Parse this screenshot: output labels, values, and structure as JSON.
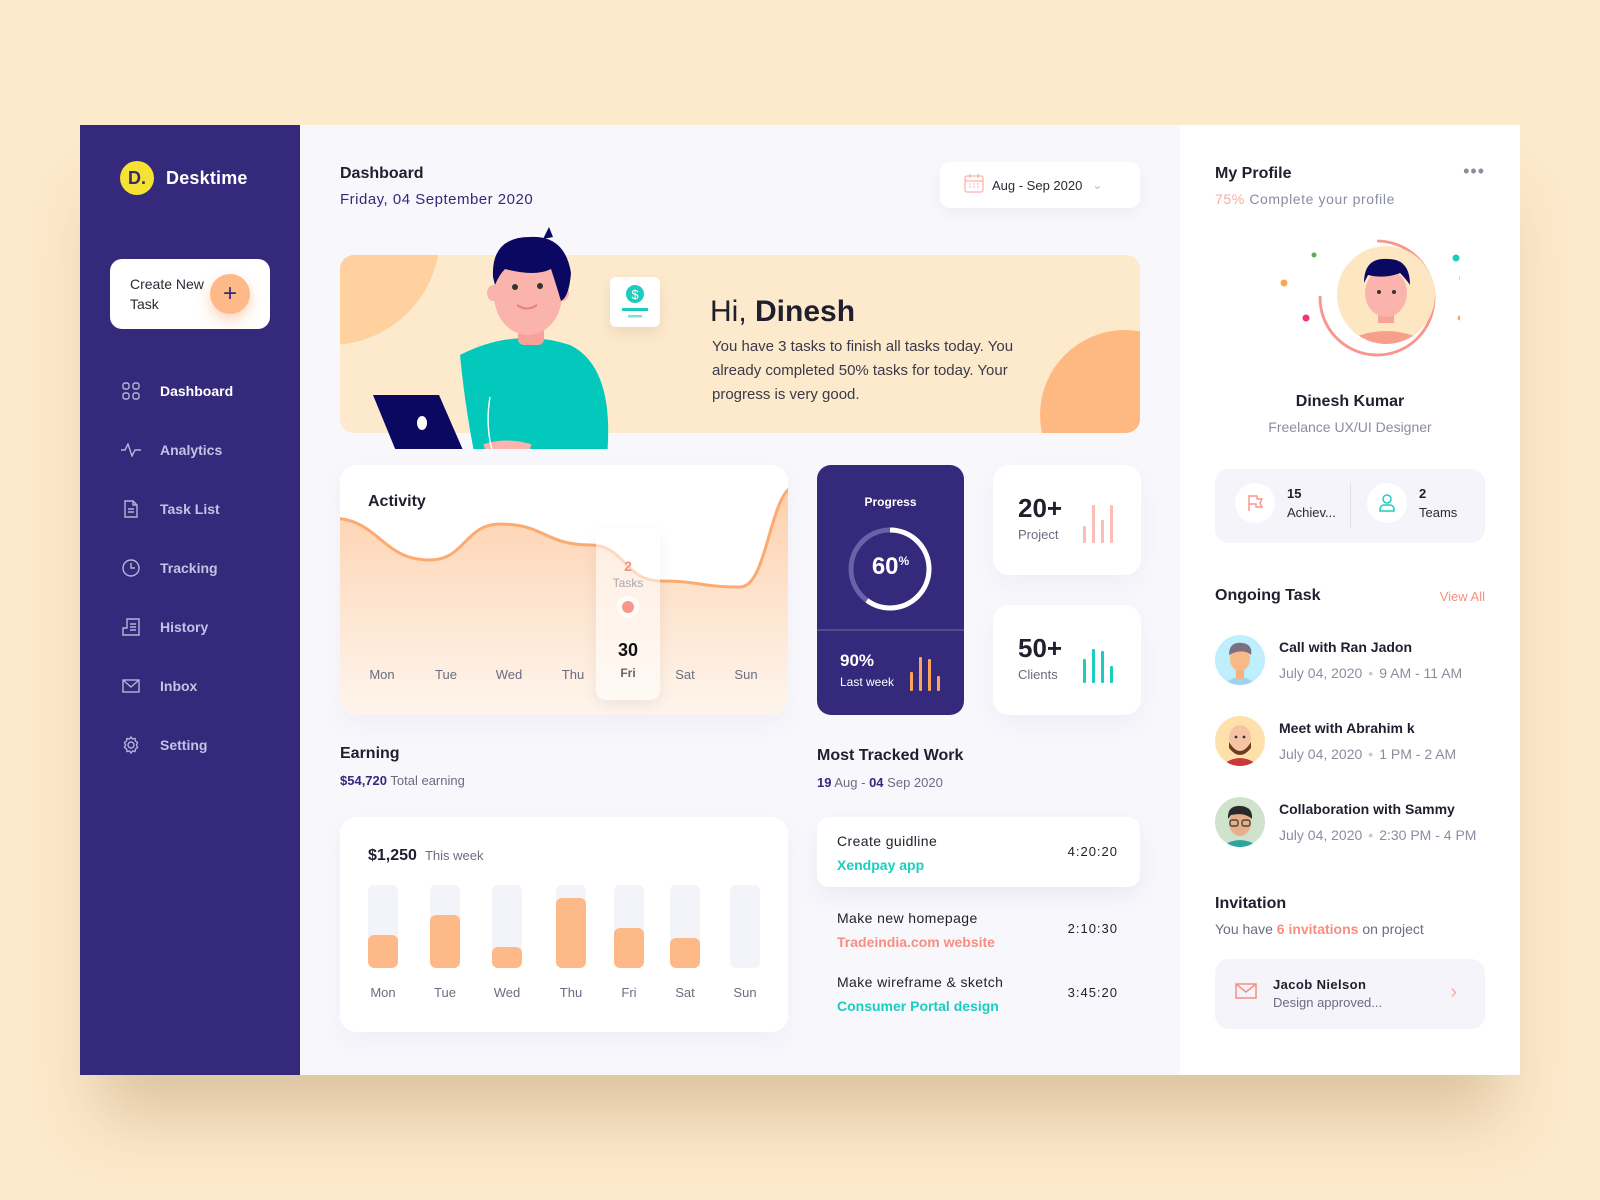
{
  "app": {
    "name": "Desktime",
    "logo_letter": "D."
  },
  "sidebar": {
    "create_button": {
      "label": "Create New Task",
      "icon": "plus-icon"
    },
    "items": [
      {
        "label": "Dashboard",
        "icon": "grid-icon",
        "active": true
      },
      {
        "label": "Analytics",
        "icon": "pulse-icon",
        "active": false
      },
      {
        "label": "Task List",
        "icon": "document-icon",
        "active": false
      },
      {
        "label": "Tracking",
        "icon": "clock-icon",
        "active": false
      },
      {
        "label": "History",
        "icon": "history-icon",
        "active": false
      },
      {
        "label": "Inbox",
        "icon": "mail-icon",
        "active": false
      },
      {
        "label": "Setting",
        "icon": "gear-icon",
        "active": false
      }
    ]
  },
  "header": {
    "title": "Dashboard",
    "date": "Friday, 04 September 2020",
    "date_range": "Aug - Sep 2020"
  },
  "banner": {
    "greeting_prefix": "Hi, ",
    "greeting_name": "Dinesh",
    "message": "You have 3 tasks to finish all tasks today. You already completed 50% tasks for today. Your progress is very good."
  },
  "activity": {
    "title": "Activity",
    "days": [
      "Mon",
      "Tue",
      "Wed",
      "Thu",
      "Fri",
      "Sat",
      "Sun"
    ],
    "tooltip": {
      "count": "2",
      "label": "Tasks",
      "date": "30",
      "day": "Fri"
    }
  },
  "progress": {
    "title": "Progress",
    "percent_value": 60,
    "percent_label": "60",
    "percent_sign": "%",
    "last_week_value": "90%",
    "last_week_label": "Last week",
    "bars": [
      0.55,
      1.0,
      0.95,
      0.45
    ]
  },
  "stats": [
    {
      "value": "20+",
      "label": "Project",
      "color": "#fcbdb6",
      "bars": [
        0.45,
        1.0,
        0.6,
        1.0
      ]
    },
    {
      "value": "50+",
      "label": "Clients",
      "color": "#1ccdbf",
      "bars": [
        0.7,
        1.0,
        0.95,
        0.5
      ]
    }
  ],
  "earning": {
    "title": "Earning",
    "total_value": "$54,720",
    "total_label": "Total earning",
    "week_value": "$1,250",
    "week_label": "This week"
  },
  "chart_data": {
    "type": "bar",
    "title": "$1,250 This week",
    "categories": [
      "Mon",
      "Tue",
      "Wed",
      "Thu",
      "Fri",
      "Sat",
      "Sun"
    ],
    "values": [
      0.4,
      0.64,
      0.25,
      0.84,
      0.48,
      0.36,
      0
    ],
    "ylim": [
      0,
      1
    ],
    "xlabel": "",
    "ylabel": "",
    "grid": false
  },
  "activity_chart": {
    "type": "area",
    "categories": [
      "Mon",
      "Tue",
      "Wed",
      "Thu",
      "Fri",
      "Sat",
      "Sun"
    ],
    "values": [
      0.78,
      0.5,
      0.74,
      0.6,
      0.36,
      0.32,
      1.0
    ],
    "highlight": "Fri"
  },
  "tracked": {
    "title": "Most Tracked Work",
    "range_start_day": "19",
    "range_start_month": "Aug",
    "range_end_day": "04",
    "range_end_rest": "Sep 2020",
    "items": [
      {
        "name": "Create guidline",
        "project": "Xendpay app",
        "time": "4:20:20",
        "color": "#1ccdbf"
      },
      {
        "name": "Make new homepage",
        "project": "Tradeindia.com website",
        "time": "2:10:30",
        "color": "#f78e80"
      },
      {
        "name": "Make wireframe & sketch",
        "project": "Consumer Portal design",
        "time": "3:45:20",
        "color": "#1ccdbf"
      }
    ]
  },
  "profile": {
    "title": "My Profile",
    "complete_pct": "75%",
    "complete_label": "Complete your profile",
    "more_icon": "more-dots-icon",
    "name": "Dinesh Kumar",
    "role": "Freelance UX/UI Designer",
    "achievements_count": "15",
    "achievements_label": "Achiev...",
    "teams_count": "2",
    "teams_label": "Teams"
  },
  "ongoing": {
    "title": "Ongoing Task",
    "view_all": "View All",
    "items": [
      {
        "title": "Call with Ran Jadon",
        "date": "July 04, 2020",
        "time": "9 AM - 11 AM",
        "avatar_bg": "#bfeefc"
      },
      {
        "title": "Meet with Abrahim k",
        "date": "July 04, 2020",
        "time": "1 PM - 2 AM",
        "avatar_bg": "#fde0aa"
      },
      {
        "title": "Collaboration with Sammy",
        "date": "July 04, 2020",
        "time": "2:30 PM - 4 PM",
        "avatar_bg": "#cfe3cc"
      }
    ]
  },
  "invitation": {
    "title": "Invitation",
    "prefix": "You have ",
    "count_text": "6 invitations",
    "suffix": " on project",
    "card": {
      "name": "Jacob Nielson",
      "message": "Design approved..."
    }
  }
}
